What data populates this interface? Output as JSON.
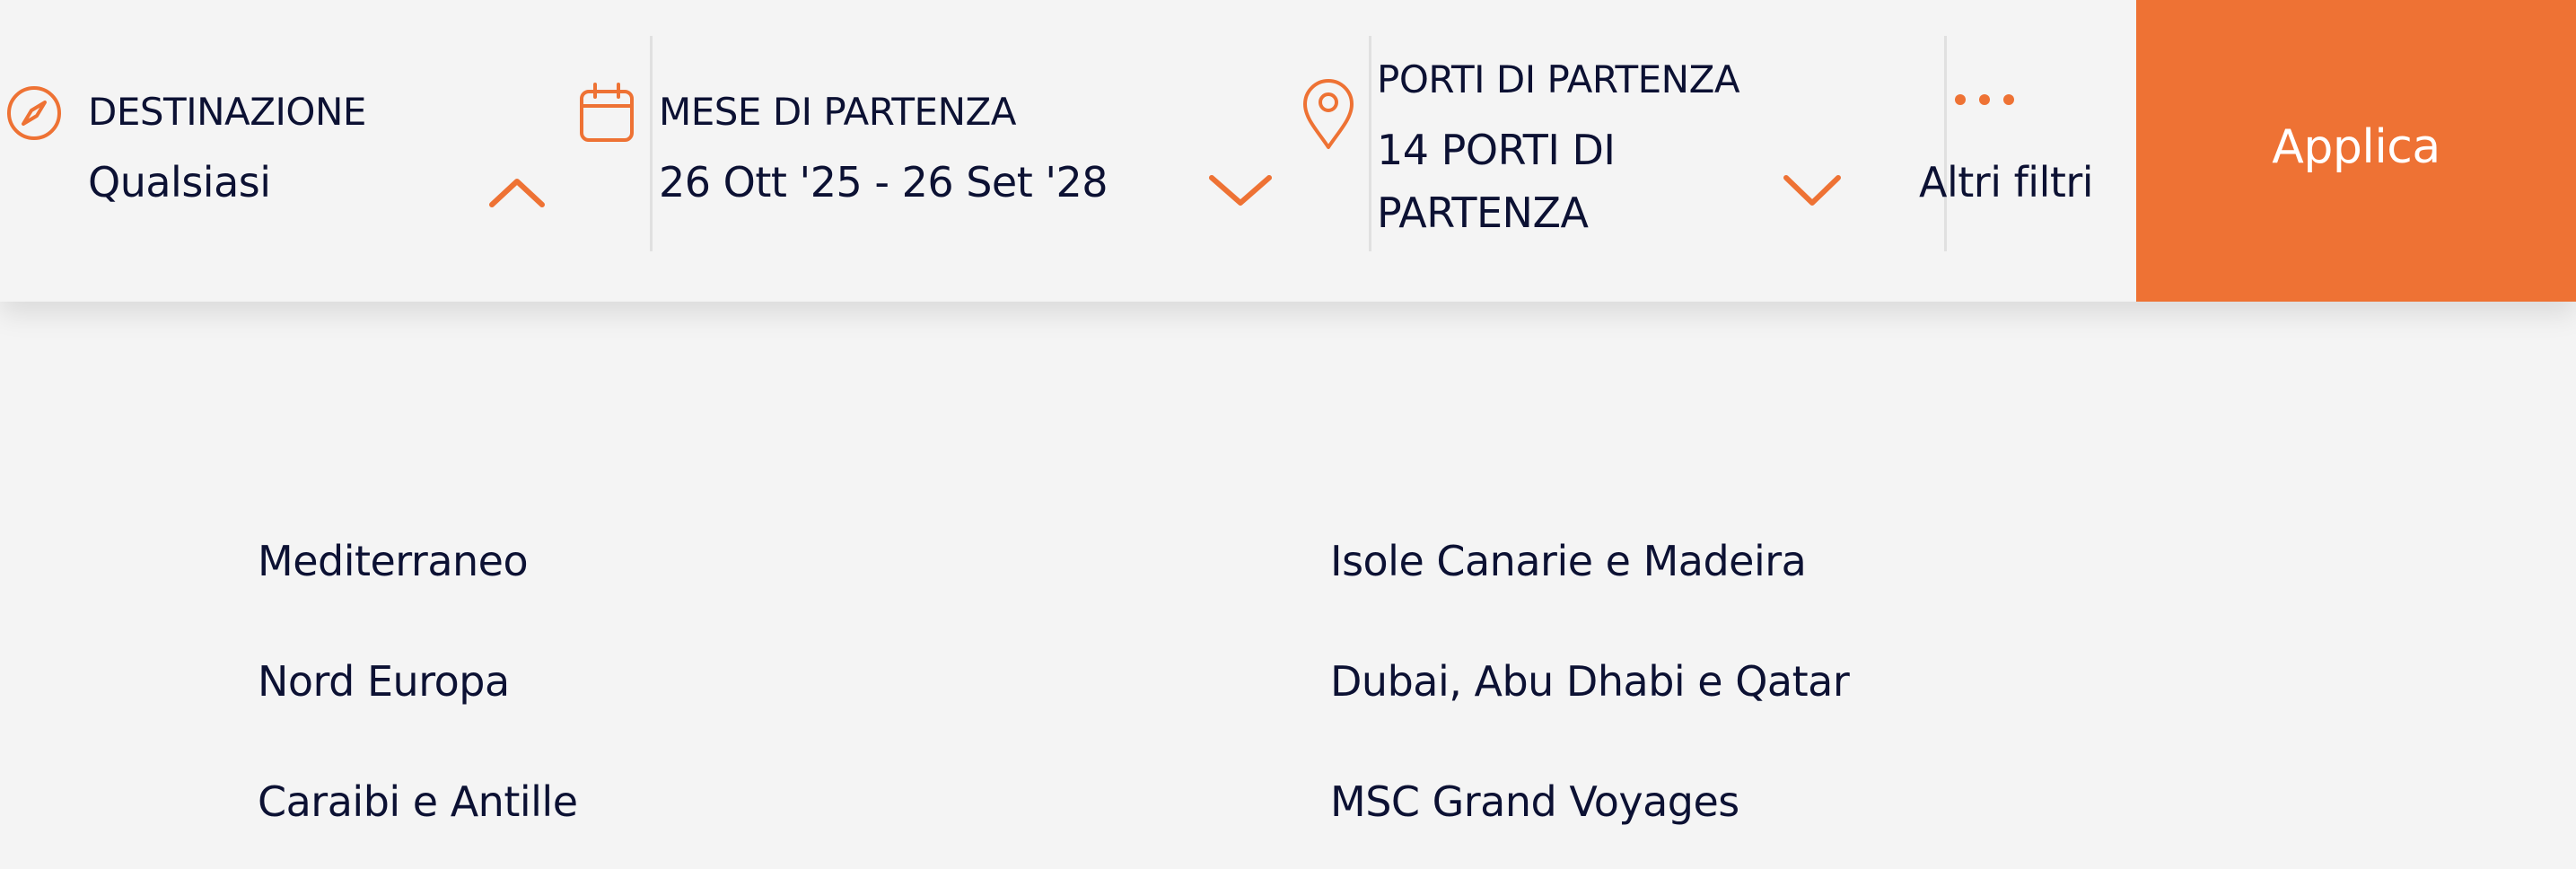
{
  "filters": {
    "destination": {
      "label": "DESTINAZIONE",
      "value": "Qualsiasi"
    },
    "month": {
      "label": "MESE DI PARTENZA",
      "value": "26 Ott '25 - 26 Set '28"
    },
    "ports": {
      "label": "PORTI DI PARTENZA",
      "value_line1": "14 PORTI DI",
      "value_line2": "PARTENZA"
    },
    "more": {
      "label": "Altri filtri"
    },
    "apply_label": "Applica"
  },
  "destinations": {
    "left": [
      "Mediterraneo",
      "Nord Europa",
      "Caraibi e Antille"
    ],
    "right": [
      "Isole Canarie e Madeira",
      "Dubai, Abu Dhabi e Qatar",
      "MSC Grand Voyages"
    ]
  },
  "colors": {
    "accent": "#ee7234",
    "text": "#0c1133",
    "background": "#f4f4f4"
  },
  "icons": {
    "destination": "compass-icon",
    "month": "calendar-icon",
    "ports": "map-pin-icon",
    "more": "dots-icon",
    "destination_chevron": "chevron-up-icon",
    "month_chevron": "chevron-down-icon",
    "ports_chevron": "chevron-down-icon"
  }
}
